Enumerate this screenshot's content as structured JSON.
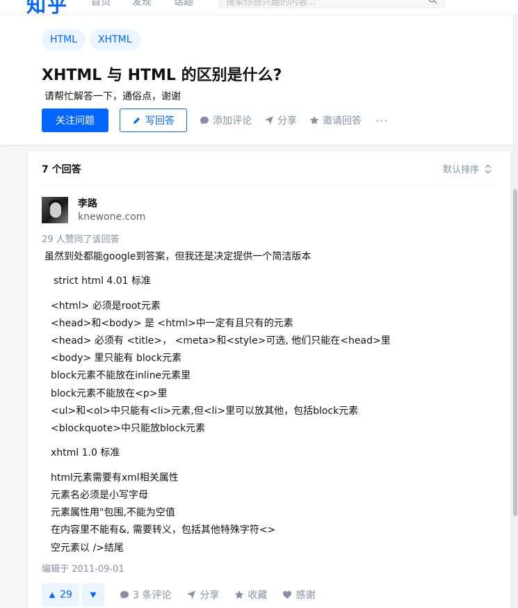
{
  "topbar": {
    "logo": "知乎",
    "nav": [
      "首页",
      "发现",
      "话题"
    ],
    "search_placeholder": "搜索你感兴趣的内容..."
  },
  "question": {
    "tags": [
      "HTML",
      "XHTML"
    ],
    "title": "XHTML 与 HTML 的区别是什么?",
    "detail": "请帮忙解答一下，通俗点，谢谢",
    "follow_label": "关注问题",
    "write_label": "写回答",
    "comment_label": "添加评论",
    "share_label": "分享",
    "invite_label": "邀请回答",
    "more_label": "···"
  },
  "answers": {
    "count_label": "7 个回答",
    "sort_label": "默认排序",
    "answer": {
      "author_name": "李路",
      "author_bio": "knewone.com",
      "upvote_text": "29 人赞同了该回答",
      "lines": [
        "虽然到处都能google到答案，但我还是决定提供一个简洁版本",
        "strict html 4.01 标准",
        "<html> 必须是root元素",
        "<head>和<body> 是 <html>中一定有且只有的元素",
        "<head> 必须有 <title>， <meta>和<style>可选, 他们只能在<head>里",
        "<body> 里只能有 block元素",
        "block元素不能放在inline元素里",
        "block元素不能放在<p>里",
        "<ul>和<ol>中只能有<li>元素,但<li>里可以放其他，包括block元素",
        "<blockquote>中只能放block元素",
        "xhtml 1.0 标准",
        "html元素需要有xml相关属性",
        "元素名必须是小写字母",
        "元素属性用\"包围,不能为空值",
        "在内容里不能有&, 需要转义，包括其他特殊字符<>",
        "空元素以 />结尾"
      ],
      "edited": "编辑于 2011-09-01",
      "vote_count": "29",
      "comments_label": "3 条评论",
      "share_label": "分享",
      "collect_label": "收藏",
      "thanks_label": "感谢"
    }
  },
  "colors": {
    "brand": "#0066ff",
    "muted": "#8590a6",
    "tag_bg": "#ebf5ff"
  }
}
